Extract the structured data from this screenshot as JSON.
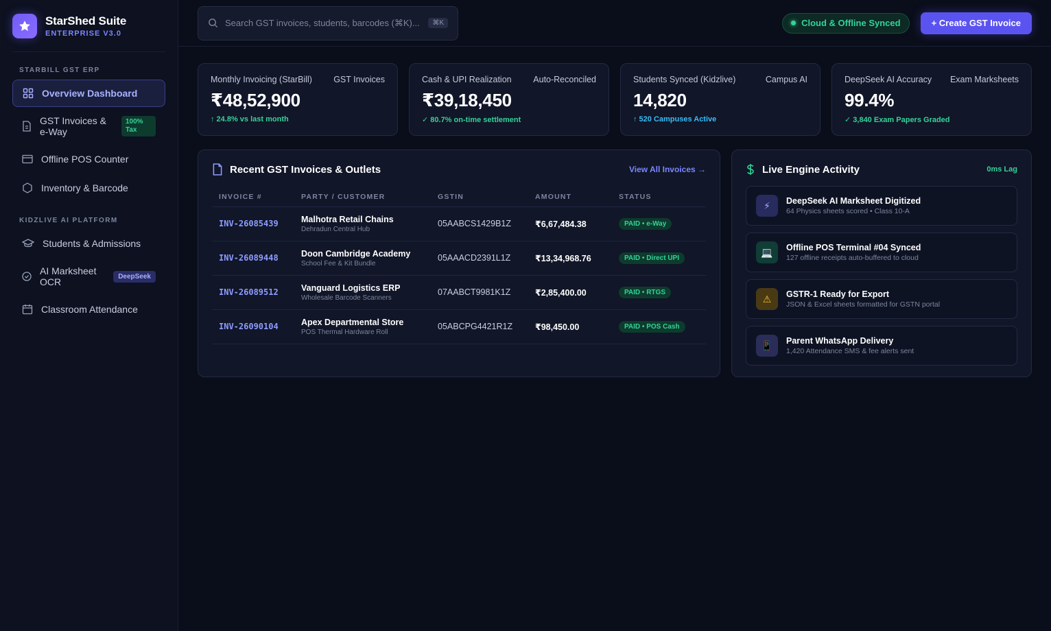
{
  "brand": {
    "name": "StarShed Suite",
    "subtitle": "ENTERPRISE V3.0"
  },
  "sidebar": {
    "section1": "STARBILL GST ERP",
    "section2": "KIDZLIVE AI PLATFORM",
    "items": [
      {
        "label": "Overview Dashboard",
        "icon": "grid-icon"
      },
      {
        "label": "GST Invoices & e-Way",
        "icon": "document-icon",
        "badge": "100% Tax"
      },
      {
        "label": "Offline POS Counter",
        "icon": "card-icon"
      },
      {
        "label": "Inventory & Barcode",
        "icon": "hexagon-icon"
      },
      {
        "label": "Students & Admissions",
        "icon": "graduation-cap-icon"
      },
      {
        "label": "AI Marksheet OCR",
        "icon": "check-circle-icon",
        "badge": "DeepSeek"
      },
      {
        "label": "Classroom Attendance",
        "icon": "calendar-icon"
      }
    ]
  },
  "search": {
    "placeholder": "Search GST invoices, students, barcodes (⌘K)...",
    "shortcut": "⌘K"
  },
  "topbar": {
    "sync_label": "Cloud & Offline Synced",
    "create_label": "+ Create GST Invoice"
  },
  "stats": [
    {
      "label": "Monthly Invoicing (StarBill)",
      "tag": "GST Invoices",
      "value": "₹48,52,900",
      "note": "↑ 24.8% vs last month",
      "color": "#34d399"
    },
    {
      "label": "Cash & UPI Realization",
      "tag": "Auto-Reconciled",
      "value": "₹39,18,450",
      "note": "✓ 80.7% on-time settlement",
      "color": "#34d399"
    },
    {
      "label": "Students Synced (Kidzlive)",
      "tag": "Campus AI",
      "value": "14,820",
      "note": "↑ 520 Campuses Active",
      "color": "#38bdf8"
    },
    {
      "label": "DeepSeek AI Accuracy",
      "tag": "Exam Marksheets",
      "value": "99.4%",
      "note": "✓ 3,840 Exam Papers Graded",
      "color": "#34d399"
    }
  ],
  "invoices": {
    "title": "Recent GST Invoices & Outlets",
    "view_all": "View All Invoices →",
    "columns": [
      "INVOICE #",
      "PARTY / CUSTOMER",
      "GSTIN",
      "AMOUNT",
      "STATUS"
    ],
    "rows": [
      {
        "id": "INV-26085439",
        "party": "Malhotra Retail Chains",
        "sub": "Dehradun Central Hub",
        "gstin": "05AABCS1429B1Z",
        "amount": "₹6,67,484.38",
        "status": "PAID • e-Way"
      },
      {
        "id": "INV-26089448",
        "party": "Doon Cambridge Academy",
        "sub": "School Fee & Kit Bundle",
        "gstin": "05AAACD2391L1Z",
        "amount": "₹13,34,968.76",
        "status": "PAID • Direct UPI"
      },
      {
        "id": "INV-26089512",
        "party": "Vanguard Logistics ERP",
        "sub": "Wholesale Barcode Scanners",
        "gstin": "07AABCT9981K1Z",
        "amount": "₹2,85,400.00",
        "status": "PAID • RTGS"
      },
      {
        "id": "INV-26090104",
        "party": "Apex Departmental Store",
        "sub": "POS Thermal Hardware Roll",
        "gstin": "05ABCPG4421R1Z",
        "amount": "₹98,450.00",
        "status": "PAID • POS Cash"
      }
    ]
  },
  "activity": {
    "title": "Live Engine Activity",
    "lag": "0ms Lag",
    "items": [
      {
        "icon": "⚡",
        "icon_name": "lightning-icon",
        "title": "DeepSeek AI Marksheet Digitized",
        "sub": "64 Physics sheets scored • Class 10-A"
      },
      {
        "icon": "💻",
        "icon_name": "laptop-icon",
        "title": "Offline POS Terminal #04 Synced",
        "sub": "127 offline receipts auto-buffered to cloud"
      },
      {
        "icon": "⚠",
        "icon_name": "warning-icon",
        "title": "GSTR-1 Ready for Export",
        "sub": "JSON & Excel sheets formatted for GSTN portal"
      },
      {
        "icon": "📱",
        "icon_name": "phone-icon",
        "title": "Parent WhatsApp Delivery",
        "sub": "1,420 Attendance SMS & fee alerts sent"
      }
    ]
  }
}
